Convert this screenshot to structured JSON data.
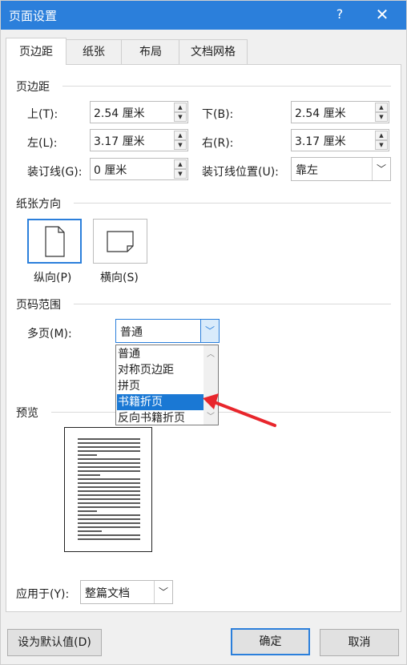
{
  "window": {
    "title": "页面设置",
    "help_label": "?",
    "close_label": "✕"
  },
  "tabs": [
    {
      "label": "页边距",
      "active": true
    },
    {
      "label": "纸张",
      "active": false
    },
    {
      "label": "布局",
      "active": false
    },
    {
      "label": "文档网格",
      "active": false
    }
  ],
  "margins": {
    "section_title": "页边距",
    "top_label": "上(T):",
    "top_value": "2.54 厘米",
    "bottom_label": "下(B):",
    "bottom_value": "2.54 厘米",
    "left_label": "左(L):",
    "left_value": "3.17 厘米",
    "right_label": "右(R):",
    "right_value": "3.17 厘米",
    "gutter_label": "装订线(G):",
    "gutter_value": "0 厘米",
    "gutter_pos_label": "装订线位置(U):",
    "gutter_pos_value": "靠左"
  },
  "orientation": {
    "section_title": "纸张方向",
    "portrait_label": "纵向(P)",
    "landscape_label": "横向(S)",
    "selected": "portrait"
  },
  "pages": {
    "section_title": "页码范围",
    "multiple_label": "多页(M):",
    "multiple_value": "普通",
    "options": [
      "普通",
      "对称页边距",
      "拼页",
      "书籍折页",
      "反向书籍折页"
    ],
    "highlighted": "书籍折页"
  },
  "preview": {
    "section_title": "预览"
  },
  "apply": {
    "label": "应用于(Y):",
    "value": "整篇文档"
  },
  "buttons": {
    "set_default": "设为默认值(D)",
    "ok": "确定",
    "cancel": "取消"
  },
  "colors": {
    "accent": "#2b7fdb",
    "highlight": "#1a78d4",
    "annotation_arrow": "#e8262c"
  }
}
